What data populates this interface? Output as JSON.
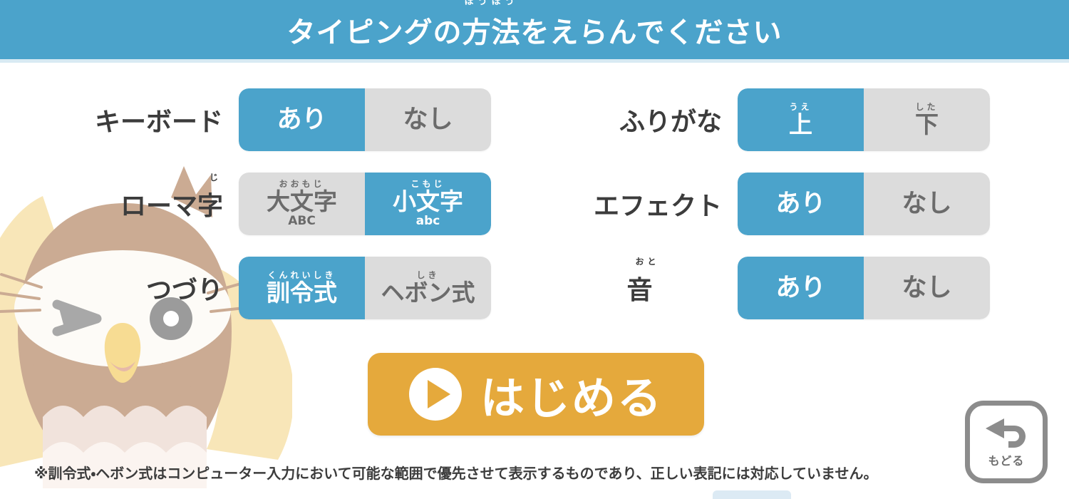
{
  "header": {
    "title_before": "タイピングの",
    "title_kanji": "方法",
    "title_ruby": "ほうほう",
    "title_after": "をえらんでください"
  },
  "settings": {
    "left_column": [
      {
        "label": "キーボード",
        "label_ruby": "",
        "options": [
          {
            "main": "あり",
            "ruby": "",
            "sub": "",
            "selected": true
          },
          {
            "main": "なし",
            "ruby": "",
            "sub": "",
            "selected": false
          }
        ]
      },
      {
        "label": "ローマ字",
        "label_ruby": "じ",
        "options": [
          {
            "main": "大文字",
            "ruby": "おおもじ",
            "sub": "ABC",
            "selected": false
          },
          {
            "main": "小文字",
            "ruby": "こもじ",
            "sub": "abc",
            "selected": true
          }
        ]
      },
      {
        "label": "つづり",
        "label_ruby": "",
        "options": [
          {
            "main": "訓令式",
            "ruby": "くんれいしき",
            "sub": "",
            "selected": true
          },
          {
            "main": "ヘボン式",
            "ruby": "しき",
            "sub": "",
            "selected": false
          }
        ]
      }
    ],
    "right_column": [
      {
        "label": "ふりがな",
        "label_ruby": "",
        "options": [
          {
            "main": "上",
            "ruby": "うえ",
            "sub": "",
            "selected": true
          },
          {
            "main": "下",
            "ruby": "した",
            "sub": "",
            "selected": false
          }
        ]
      },
      {
        "label": "エフェクト",
        "label_ruby": "",
        "options": [
          {
            "main": "あり",
            "ruby": "",
            "sub": "",
            "selected": true
          },
          {
            "main": "なし",
            "ruby": "",
            "sub": "",
            "selected": false
          }
        ]
      },
      {
        "label": "音",
        "label_ruby": "おと",
        "options": [
          {
            "main": "あり",
            "ruby": "",
            "sub": "",
            "selected": true
          },
          {
            "main": "なし",
            "ruby": "",
            "sub": "",
            "selected": false
          }
        ]
      }
    ]
  },
  "start_button": {
    "label": "はじめる",
    "icon": "play-icon"
  },
  "back_button": {
    "label": "もどる",
    "icon": "back-arrow-icon"
  },
  "footnote": "※訓令式・ヘボン式はコンピューター入力において可能な範囲で優先させて表示するものであり、正しい表記には対応していません。",
  "colors": {
    "header_blue": "#4ba3cb",
    "selected_blue": "#4ba3cb",
    "unselected_gray": "#dcdcdc",
    "unselected_text": "#6b6b6b",
    "start_orange": "#e5a93c",
    "text_dark": "#3c3c3c",
    "back_gray": "#8c8c8c"
  },
  "mascot": {
    "name": "owl-mascot",
    "body_color": "#c9ab96",
    "wing_color": "#f7e3b0",
    "face_color": "#fdfaf6",
    "beak_color": "#f5d98a"
  }
}
